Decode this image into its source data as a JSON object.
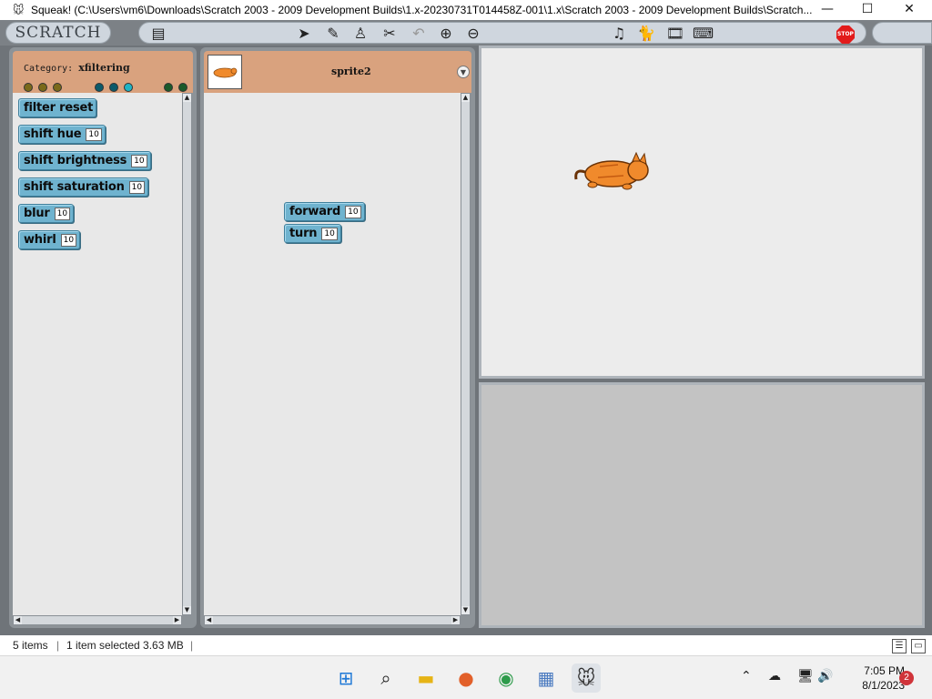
{
  "window": {
    "title": "Squeak! (C:\\Users\\vm6\\Downloads\\Scratch 2003 - 2009 Development Builds\\1.x-20230731T014458Z-001\\1.x\\Scratch 2003 - 2009 Development Builds\\Scratch...",
    "minimize_glyph": "—",
    "maximize_glyph": "☐",
    "close_glyph": "✕"
  },
  "toolbar": {
    "logo": "SCRATCH",
    "stop_label": "STOP"
  },
  "palette": {
    "category_prefix": "Category:",
    "category_name": "xfiltering",
    "blocks": [
      {
        "label": "filter reset",
        "value": null
      },
      {
        "label": "shift hue",
        "value": "10"
      },
      {
        "label": "shift brightness",
        "value": "10"
      },
      {
        "label": "shift saturation",
        "value": "10"
      },
      {
        "label": "blur",
        "value": "10"
      },
      {
        "label": "whirl",
        "value": "10"
      }
    ],
    "dot_colors": [
      "#7a6a1a",
      "#7a6a1a",
      "#7a6a1a",
      "#0c5a6a",
      "#0c5a6a",
      "#1fb4c4",
      "#1b5a2a",
      "#1b5a2a"
    ]
  },
  "script_pane": {
    "sprite_name": "sprite2",
    "blocks": [
      {
        "label": "forward",
        "value": "10"
      },
      {
        "label": "turn",
        "value": "10"
      }
    ]
  },
  "status": {
    "items": "5 items",
    "selected": "1 item selected  3.63 MB"
  },
  "taskbar": {
    "time": "7:05 PM",
    "date": "8/1/2023",
    "notifications": "2"
  },
  "colors": {
    "block_blue": "#6fb3cf",
    "header_orange": "#d9a27e",
    "sprite_orange": "#f08a2c"
  }
}
